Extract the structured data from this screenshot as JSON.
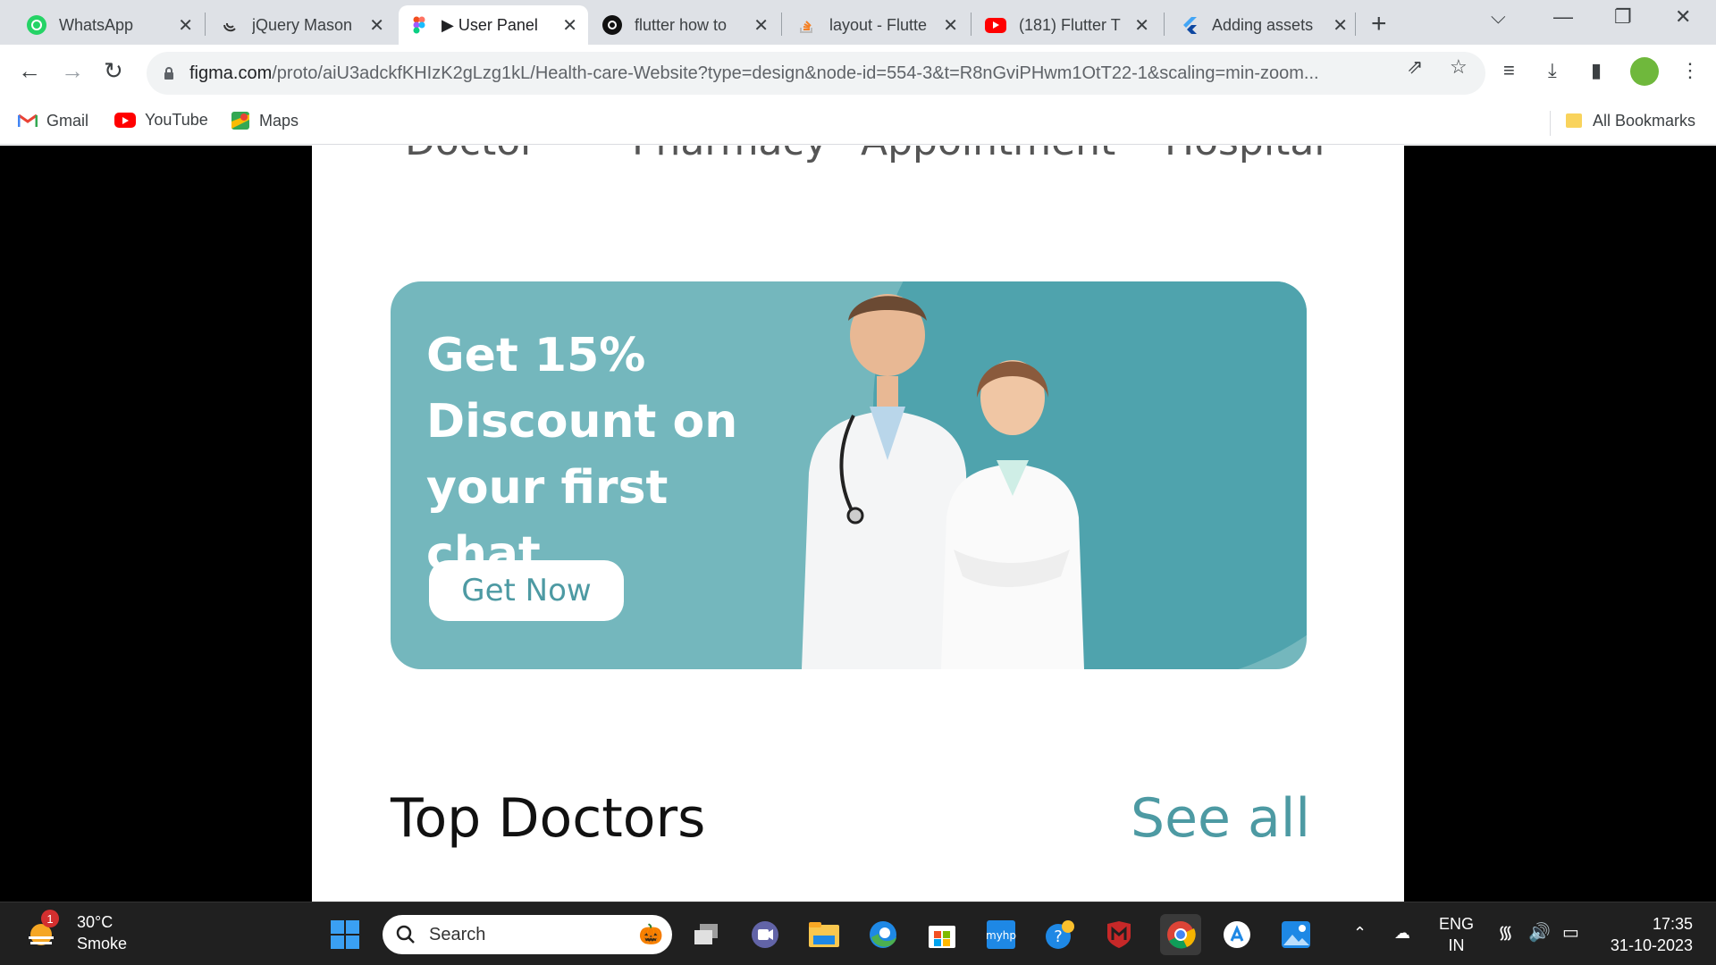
{
  "browser": {
    "tabs": [
      {
        "label": "WhatsApp",
        "icon": "whatsapp-icon"
      },
      {
        "label": "jQuery Mason",
        "icon": "jquery-icon"
      },
      {
        "label": "▶ User Panel",
        "icon": "figma-icon"
      },
      {
        "label": "flutter how to",
        "icon": "chatgpt-icon"
      },
      {
        "label": "layout - Flutte",
        "icon": "stackoverflow-icon"
      },
      {
        "label": "(181) Flutter T",
        "icon": "youtube-icon"
      },
      {
        "label": "Adding assets",
        "icon": "flutter-icon"
      }
    ],
    "url_host": "figma.com",
    "url_path": "/proto/aiU3adckfKHIzK2gLzg1kL/Health-care-Website?type=design&node-id=554-3&t=R8nGviPHwm1OtT22-1&scaling=min-zoom...",
    "bookmarks": [
      {
        "label": "Gmail",
        "icon": "gmail-icon"
      },
      {
        "label": "YouTube",
        "icon": "youtube-icon"
      },
      {
        "label": "Maps",
        "icon": "maps-icon"
      }
    ],
    "all_bookmarks": "All Bookmarks"
  },
  "page": {
    "categories": [
      "Doctor",
      "Pharmacy",
      "Appointment",
      "Hospital"
    ],
    "banner": {
      "headline": "Get 15% Discount on your first chat",
      "cta": "Get Now",
      "bg_color": "#74b7bd",
      "accent_color": "#4fa3ad"
    },
    "section": {
      "title": "Top Doctors",
      "see_all": "See all"
    }
  },
  "taskbar": {
    "weather_temp": "30°C",
    "weather_desc": "Smoke",
    "weather_badge": "1",
    "search_placeholder": "Search",
    "lang_line1": "ENG",
    "lang_line2": "IN",
    "time": "17:35",
    "date": "31-10-2023"
  }
}
